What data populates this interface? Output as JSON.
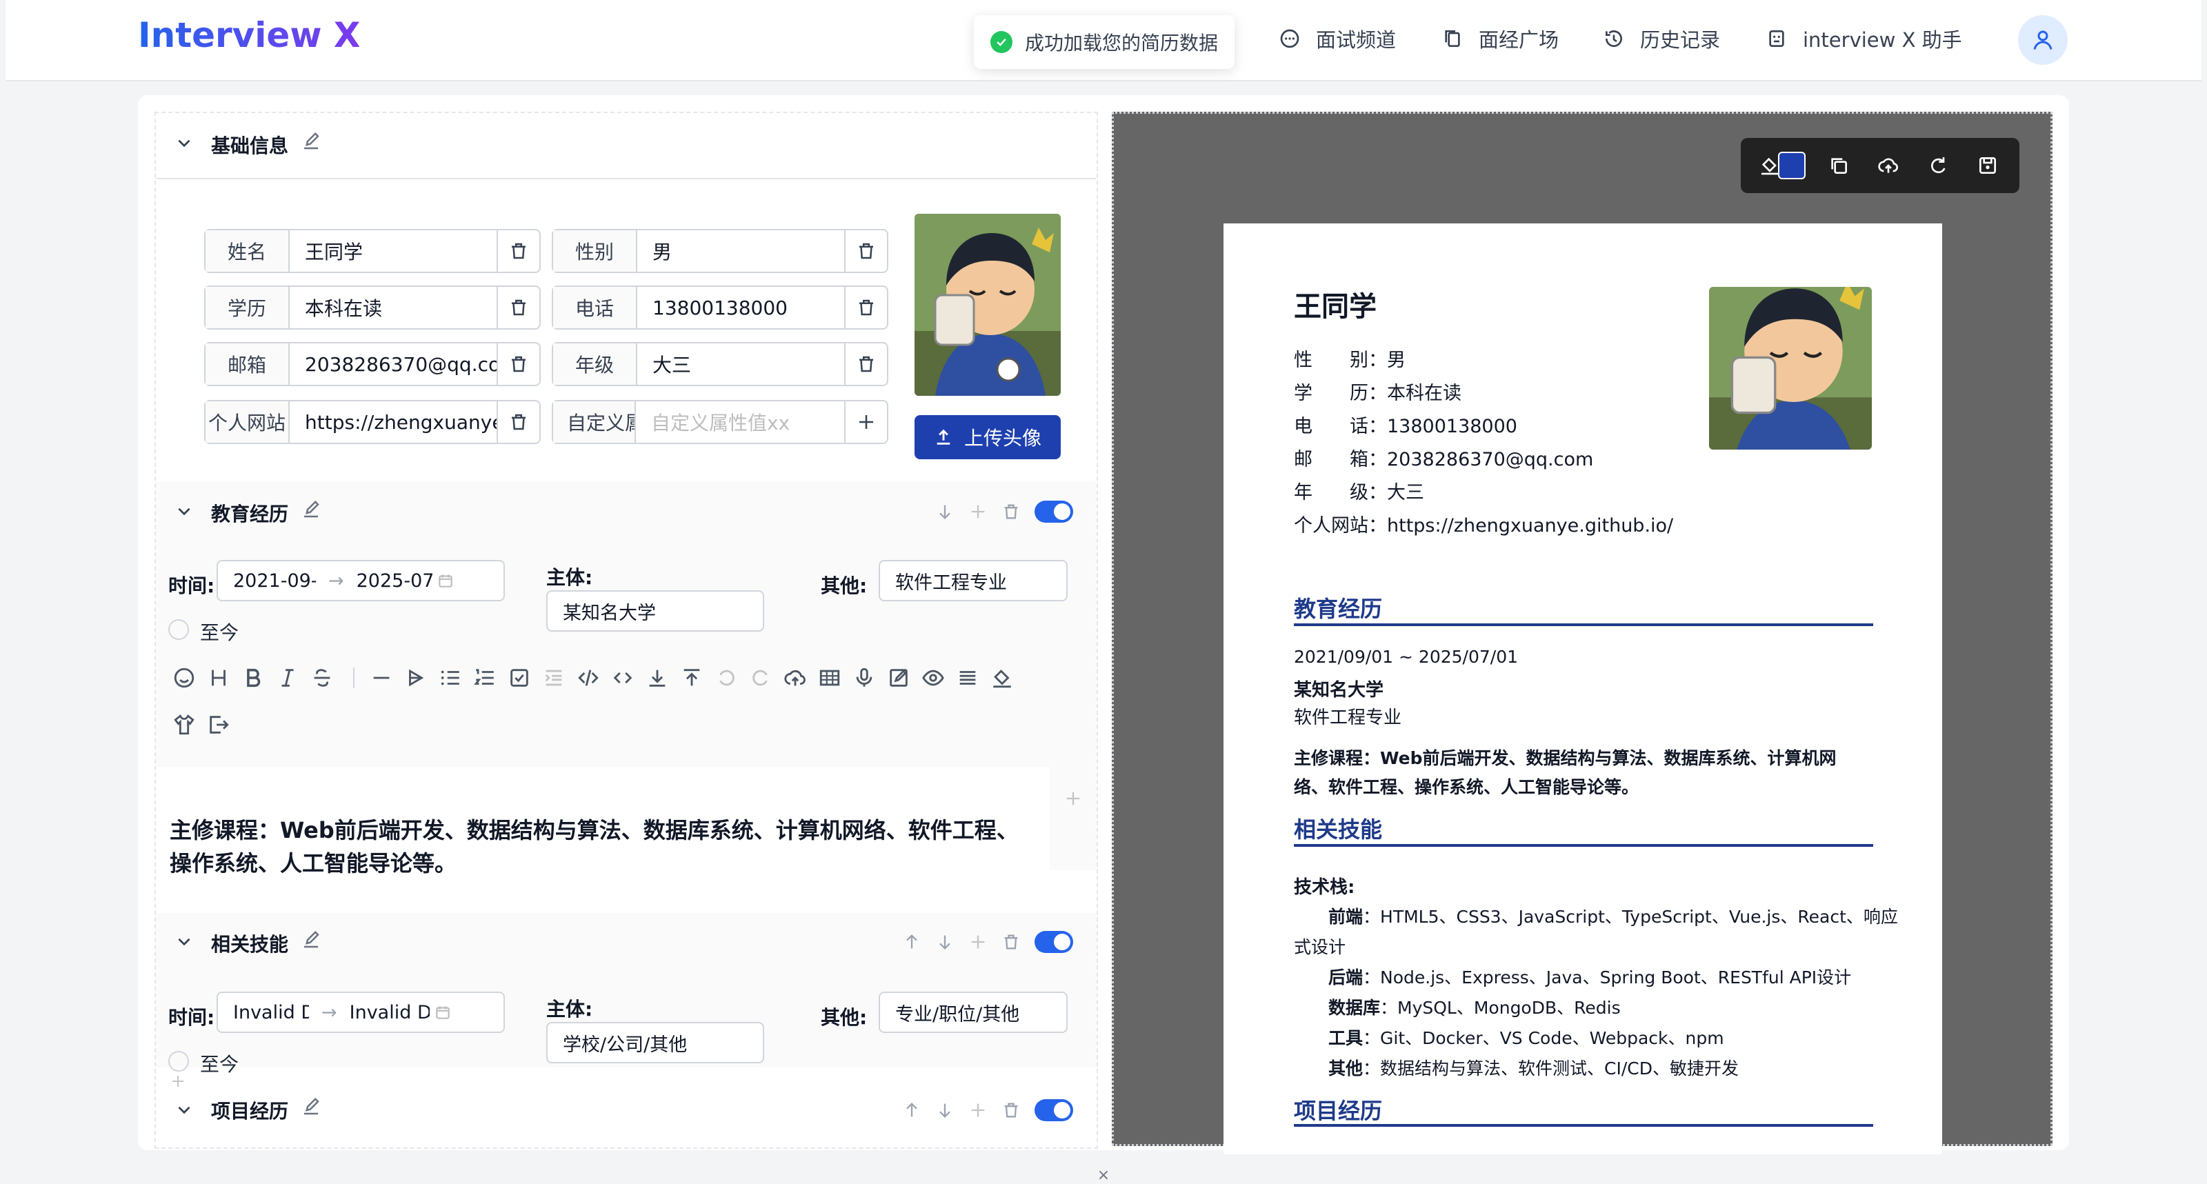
{
  "header": {
    "logo": "Interview X",
    "nav": [
      {
        "label": "面试频道",
        "icon": "chat-icon"
      },
      {
        "label": "面经广场",
        "icon": "copy-icon"
      },
      {
        "label": "历史记录",
        "icon": "history-icon"
      },
      {
        "label": "interview X 助手",
        "icon": "robot-icon"
      }
    ],
    "user_icon": "user-icon"
  },
  "toast": {
    "text": "成功加载您的简历数据"
  },
  "basic": {
    "title": "基础信息",
    "fields": [
      {
        "label": "姓名",
        "value": "王同学"
      },
      {
        "label": "性别",
        "value": "男"
      },
      {
        "label": "学历",
        "value": "本科在读"
      },
      {
        "label": "电话",
        "value": "13800138000"
      },
      {
        "label": "邮箱",
        "value": "2038286370@qq.com"
      },
      {
        "label": "年级",
        "value": "大三"
      },
      {
        "label": "个人网站",
        "value": "https://zhengxuanye.github.io/"
      }
    ],
    "custom": {
      "label_placeholder": "自定义属性",
      "value_placeholder": "自定义属性值xx"
    },
    "upload_label": "上传头像"
  },
  "education": {
    "title": "教育经历",
    "time_label": "时间:",
    "start": "2021-09-01",
    "end": "2025-07-01",
    "now_label": "至今",
    "subject_label": "主体:",
    "subject": "某知名大学",
    "other_label": "其他:",
    "other": "软件工程专业",
    "content": "主修课程：Web前后端开发、数据结构与算法、数据库系统、计算机网络、软件工程、操作系统、人工智能导论等。"
  },
  "skills": {
    "title": "相关技能",
    "time_label": "时间:",
    "start": "Invalid Date",
    "end": "Invalid Date",
    "now_label": "至今",
    "subject_label": "主体:",
    "subject_placeholder": "学校/公司/其他",
    "other_label": "其他:",
    "other_placeholder": "专业/职位/其他"
  },
  "projects": {
    "title": "项目经历"
  },
  "preview": {
    "name": "王同学",
    "info": [
      {
        "label": "性　　别：",
        "value": "男"
      },
      {
        "label": "学　　历：",
        "value": "本科在读"
      },
      {
        "label": "电　　话：",
        "value": "13800138000"
      },
      {
        "label": "邮　　箱：",
        "value": "2038286370@qq.com"
      },
      {
        "label": "年　　级：",
        "value": "大三"
      },
      {
        "label": "个人网站：",
        "value": "https://zhengxuanye.github.io/"
      }
    ],
    "edu_title": "教育经历",
    "edu_time": "2021/09/01 ~ 2025/07/01",
    "edu_school": "某知名大学",
    "edu_major": "软件工程专业",
    "edu_content_1": "主修课程：Web前后端开发、数据结构与算法、数据库系统、计算机网",
    "edu_content_2": "络、软件工程、操作系统、人工智能导论等。",
    "skills_title": "相关技能",
    "tech_label": "技术栈:",
    "skills": [
      {
        "label": "前端",
        "value": "：HTML5、CSS3、JavaScript、TypeScript、Vue.js、React、响应"
      },
      {
        "label": "",
        "value": "式设计"
      },
      {
        "label": "后端",
        "value": "：Node.js、Express、Java、Spring Boot、RESTful API设计"
      },
      {
        "label": "数据库",
        "value": "：MySQL、MongoDB、Redis"
      },
      {
        "label": "工具",
        "value": "：Git、Docker、VS Code、Webpack、npm"
      },
      {
        "label": "其他",
        "value": "：数据结构与算法、软件测试、CI/CD、敏捷开发"
      }
    ],
    "proj_title": "项目经历",
    "theme_color": "#1e3a8a"
  },
  "colors": {
    "accent": "#2563eb",
    "upload": "#1e40af",
    "success": "#22c55e"
  }
}
